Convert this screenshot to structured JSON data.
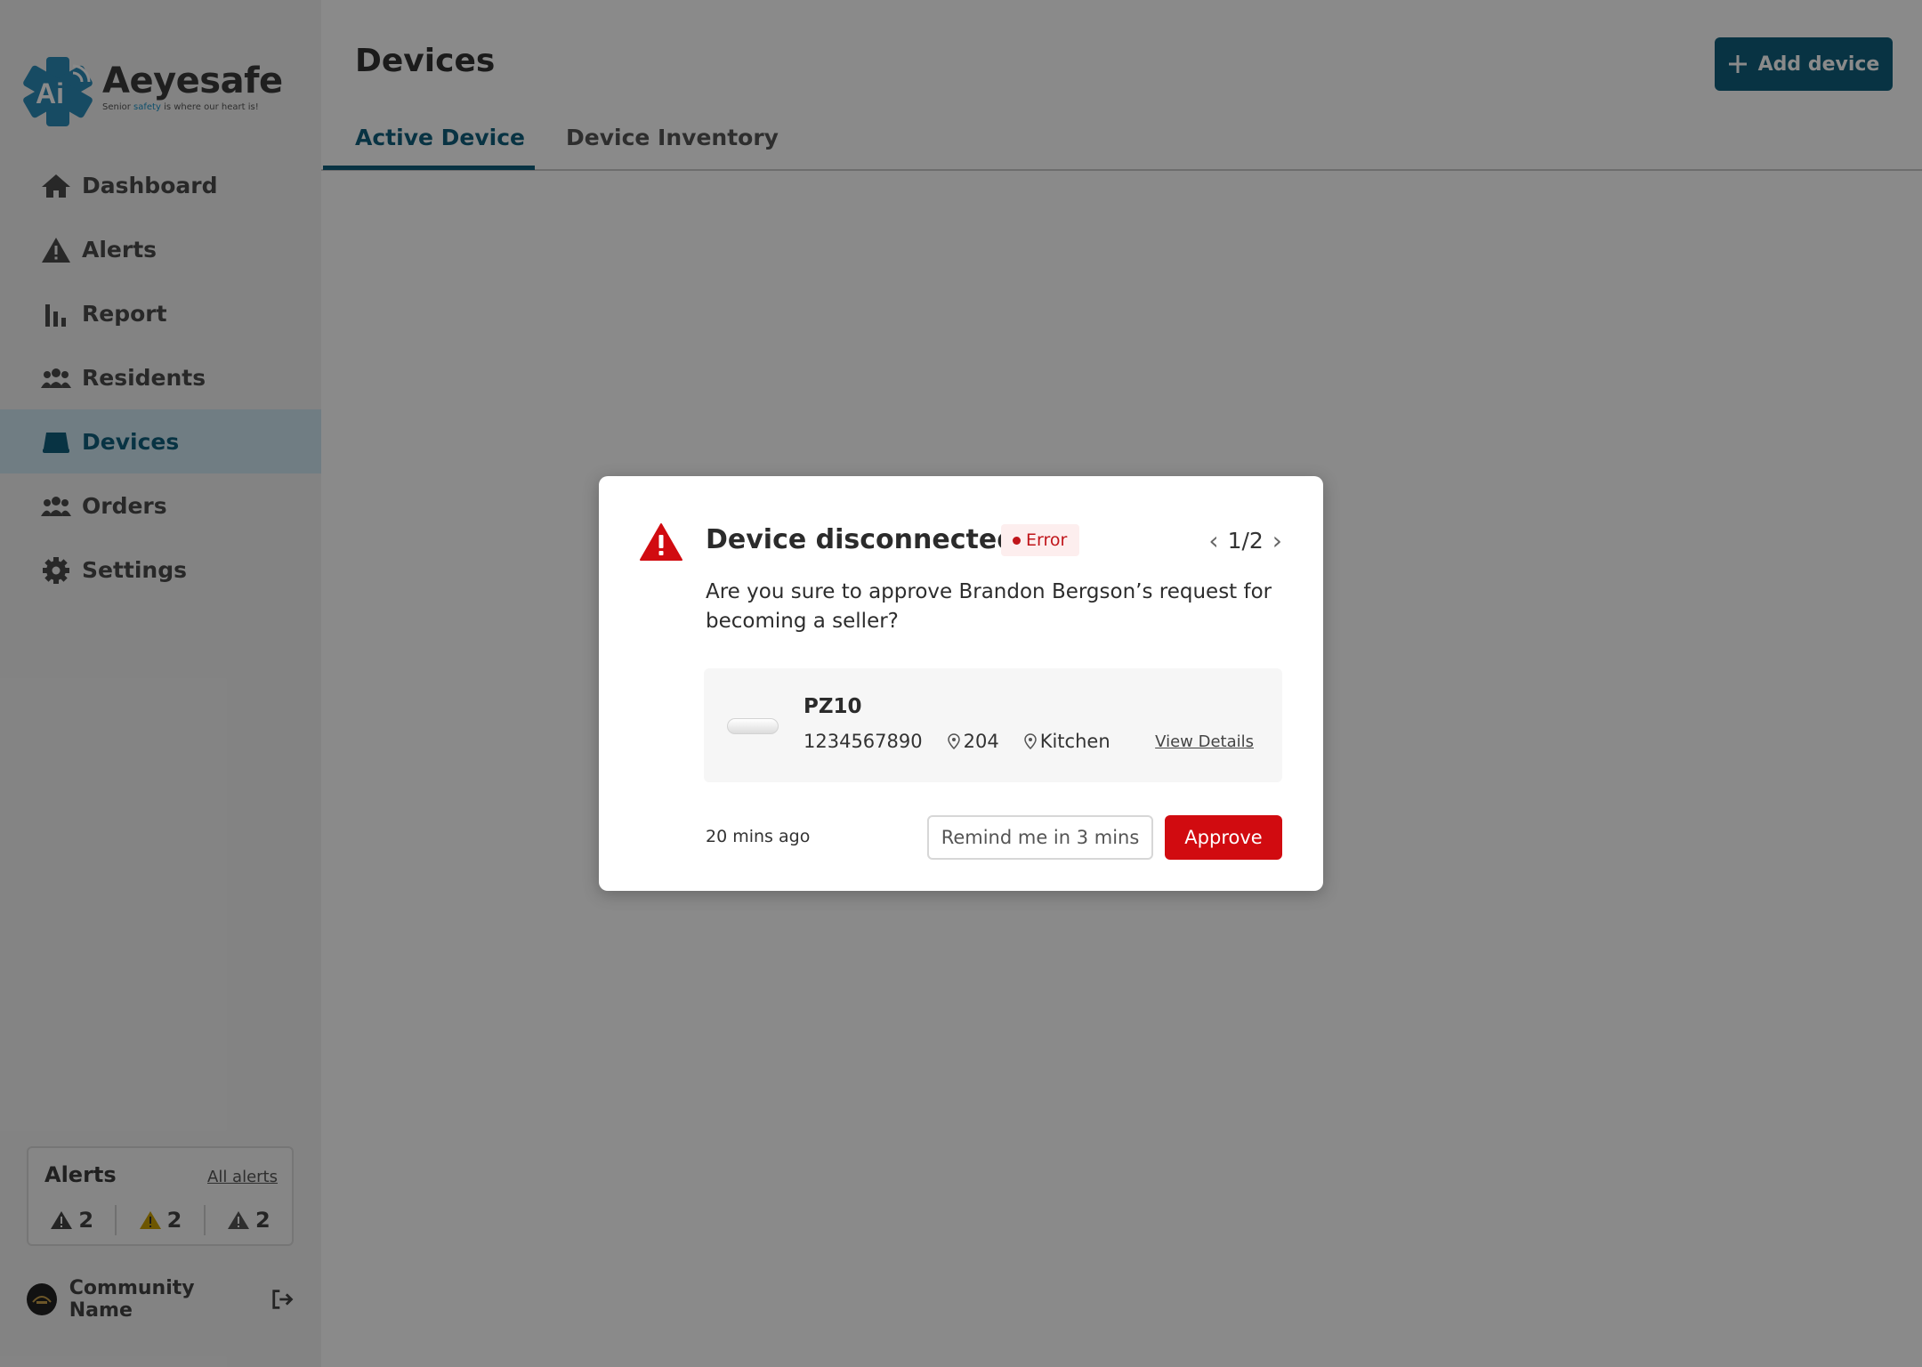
{
  "brand": {
    "name": "Aeyesafe",
    "logo_mark": "Ai",
    "tagline_pre": "Senior ",
    "tagline_highlight": "safety",
    "tagline_post": " is where our heart is!"
  },
  "sidebar": {
    "items": [
      {
        "label": "Dashboard",
        "icon": "home-icon"
      },
      {
        "label": "Alerts",
        "icon": "warning-icon"
      },
      {
        "label": "Report",
        "icon": "bar-chart-icon"
      },
      {
        "label": "Residents",
        "icon": "people-icon"
      },
      {
        "label": "Devices",
        "icon": "device-icon",
        "active": true
      },
      {
        "label": "Orders",
        "icon": "people-icon"
      },
      {
        "label": "Settings",
        "icon": "gear-icon"
      }
    ],
    "alerts_card": {
      "title": "Alerts",
      "link": "All alerts",
      "counts": [
        {
          "value": "2",
          "color": "#444444"
        },
        {
          "value": "2",
          "color": "#c9a000"
        },
        {
          "value": "2",
          "color": "#555555"
        }
      ]
    },
    "community": {
      "name": "Community Name"
    }
  },
  "header": {
    "title": "Devices",
    "add_button": "Add device",
    "tabs": [
      "Active Device",
      "Device Inventory"
    ]
  },
  "modal": {
    "title": "Device disconnected",
    "badge": "Error",
    "pager": "1/2",
    "message": "Are you sure to approve Brandon Bergson’s request for becoming a seller?",
    "device": {
      "name": "PZ10",
      "serial": "1234567890",
      "room": "204",
      "location": "Kitchen",
      "link": "View Details"
    },
    "time": "20 mins ago",
    "remind_button": "Remind me in 3 mins",
    "approve_button": "Approve"
  },
  "colors": {
    "accent": "#0f5f7d",
    "danger": "#d10b10",
    "overlay": "rgba(0,0,0,0.46)"
  }
}
